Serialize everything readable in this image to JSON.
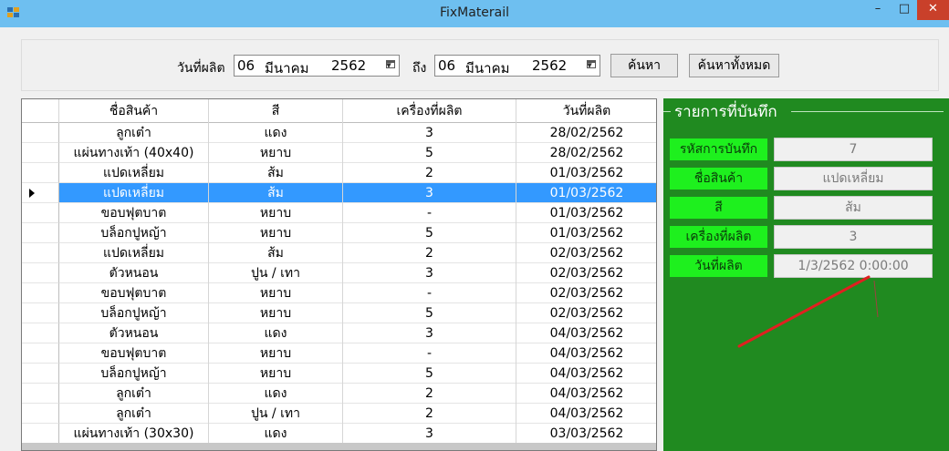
{
  "window": {
    "title": "FixMaterail",
    "minimize_glyph": "–",
    "maximize_glyph": "□",
    "close_glyph": "✕"
  },
  "search": {
    "date_label": "วันที่ผลิต",
    "from": {
      "day": "06",
      "month": "มีนาคม",
      "year": "2562"
    },
    "to_label": "ถึง",
    "to": {
      "day": "06",
      "month": "มีนาคม",
      "year": "2562"
    },
    "search_button": "ค้นหา",
    "search_all_button": "ค้นหาทั้งหมด"
  },
  "grid": {
    "columns": [
      "ชื่อสินค้า",
      "สี",
      "เครื่องที่ผลิต",
      "วันที่ผลิต"
    ],
    "selected_index": 3,
    "rows": [
      [
        "ลูกเต๋า",
        "แดง",
        "3",
        "28/02/2562"
      ],
      [
        "แผ่นทางเท้า (40x40)",
        "หยาบ",
        "5",
        "28/02/2562"
      ],
      [
        "แปดเหลี่ยม",
        "ส้ม",
        "2",
        "01/03/2562"
      ],
      [
        "แปดเหลี่ยม",
        "ส้ม",
        "3",
        "01/03/2562"
      ],
      [
        "ขอบฟุตบาต",
        "หยาบ",
        "-",
        "01/03/2562"
      ],
      [
        "บล็อกปูหญ้า",
        "หยาบ",
        "5",
        "01/03/2562"
      ],
      [
        "แปดเหลี่ยม",
        "ส้ม",
        "2",
        "02/03/2562"
      ],
      [
        "ตัวหนอน",
        "ปูน / เทา",
        "3",
        "02/03/2562"
      ],
      [
        "ขอบฟุตบาต",
        "หยาบ",
        "-",
        "02/03/2562"
      ],
      [
        "บล็อกปูหญ้า",
        "หยาบ",
        "5",
        "02/03/2562"
      ],
      [
        "ตัวหนอน",
        "แดง",
        "3",
        "04/03/2562"
      ],
      [
        "ขอบฟุตบาต",
        "หยาบ",
        "-",
        "04/03/2562"
      ],
      [
        "บล็อกปูหญ้า",
        "หยาบ",
        "5",
        "04/03/2562"
      ],
      [
        "ลูกเต๋า",
        "แดง",
        "2",
        "04/03/2562"
      ],
      [
        "ลูกเต๋า",
        "ปูน / เทา",
        "2",
        "04/03/2562"
      ],
      [
        "แผ่นทางเท้า (30x30)",
        "แดง",
        "3",
        "03/03/2562"
      ]
    ]
  },
  "detail": {
    "title": "รายการที่บันทึก",
    "fields": [
      {
        "label": "รหัสการบันทึก",
        "value": "7"
      },
      {
        "label": "ชื่อสินค้า",
        "value": "แปดเหลี่ยม"
      },
      {
        "label": "สี",
        "value": "ส้ม"
      },
      {
        "label": "เครื่องที่ผลิต",
        "value": "3"
      },
      {
        "label": "วันที่ผลิต",
        "value": "1/3/2562 0:00:00"
      }
    ]
  },
  "colors": {
    "titlebar": "#6ebff0",
    "panel_bg": "#208a20",
    "label_bg": "#1ef01e",
    "selected_row": "#3399ff",
    "annotation": "#e02020"
  }
}
